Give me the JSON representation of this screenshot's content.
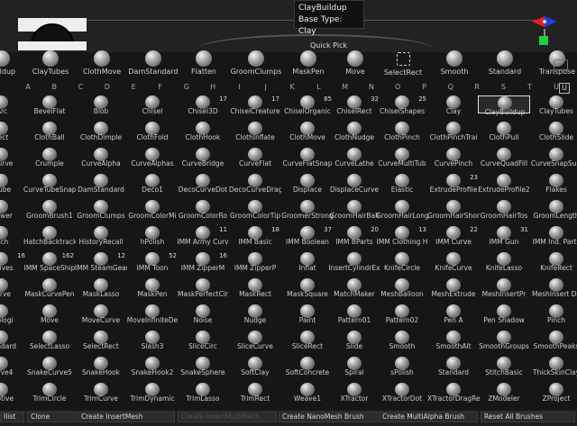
{
  "tooltip": {
    "title": "ClayBuildup",
    "subtitle": "Base Type: Clay"
  },
  "quick_pick": {
    "label": "Quick Pick",
    "items": [
      "Buildup",
      "ClayTubes",
      "ClothMove",
      "DamStandard",
      "Flatten",
      "GroomClumps",
      "MaskPen",
      "Move",
      "SelectRect",
      "Smooth",
      "Standard",
      "Transpose"
    ]
  },
  "letters": [
    "A",
    "B",
    "C",
    "D",
    "E",
    "F",
    "G",
    "H",
    "I",
    "J",
    "K",
    "L",
    "M",
    "N",
    "O",
    "P",
    "Q",
    "R",
    "S",
    "T",
    "U"
  ],
  "brush_rows": [
    [
      {
        "n": "lArc"
      },
      {
        "n": "BevelFlat"
      },
      {
        "n": "Blob"
      },
      {
        "n": "Chisel"
      },
      {
        "n": "Chisel3D",
        "c": "17"
      },
      {
        "n": "ChiselCreature",
        "c": "17"
      },
      {
        "n": "ChiselOrganic",
        "c": "85"
      },
      {
        "n": "ChiselRect",
        "c": "32"
      },
      {
        "n": "ChiselShapes",
        "c": "25"
      },
      {
        "n": "Clay"
      },
      {
        "n": "ClayBuildup",
        "hl": true
      },
      {
        "n": "ClayTubes"
      }
    ],
    [
      {
        "n": "Rect"
      },
      {
        "n": "ClothBall"
      },
      {
        "n": "ClothDimple"
      },
      {
        "n": "ClothFold"
      },
      {
        "n": "ClothHook"
      },
      {
        "n": "ClothInflate"
      },
      {
        "n": "ClothMove"
      },
      {
        "n": "ClothNudge"
      },
      {
        "n": "ClothPinch"
      },
      {
        "n": "ClothPinchTrai"
      },
      {
        "n": "ClothPull"
      },
      {
        "n": "ClothSlide"
      }
    ],
    [
      {
        "n": "eCurve"
      },
      {
        "n": "Crumple"
      },
      {
        "n": "CurveAlpha"
      },
      {
        "n": "CurveAlphas"
      },
      {
        "n": "CurveBridge"
      },
      {
        "n": "CurveFlat"
      },
      {
        "n": "CurveFlatSnap"
      },
      {
        "n": "CurveLathe"
      },
      {
        "n": "CurveMultiTub"
      },
      {
        "n": "CurvePinch"
      },
      {
        "n": "CurveQuadFill"
      },
      {
        "n": "CurveSnapSurf"
      }
    ],
    [
      {
        "n": "eTube"
      },
      {
        "n": "CurveTubeSnap"
      },
      {
        "n": "DamStandard"
      },
      {
        "n": "Deco1"
      },
      {
        "n": "DecoCurveDot"
      },
      {
        "n": "DecoCurveDrag"
      },
      {
        "n": "Displace"
      },
      {
        "n": "DisplaceCurve"
      },
      {
        "n": "Elastic"
      },
      {
        "n": "ExtrudeProfile",
        "c": "23"
      },
      {
        "n": "ExtrudeProfile2"
      },
      {
        "n": "Flakes"
      }
    ],
    [
      {
        "n": "Blower"
      },
      {
        "n": "GroomBrush1"
      },
      {
        "n": "GroomClumps"
      },
      {
        "n": "GroomColorMi"
      },
      {
        "n": "GroomColorRo"
      },
      {
        "n": "GroomColorTip"
      },
      {
        "n": "GroomerStrong"
      },
      {
        "n": "GroomHairBall"
      },
      {
        "n": "GroomHairLong"
      },
      {
        "n": "GroomHairShor"
      },
      {
        "n": "GroomHairTos"
      },
      {
        "n": "GroomLength"
      }
    ],
    [
      {
        "n": "atch"
      },
      {
        "n": "HatchBacktrack"
      },
      {
        "n": "HistoryRecall"
      },
      {
        "n": "hPolish"
      },
      {
        "n": "IMM Army Curv",
        "c": "11"
      },
      {
        "n": "IMM Basic",
        "c": "18"
      },
      {
        "n": "IMM Boolean",
        "c": "37"
      },
      {
        "n": "IMM BParts",
        "c": "20"
      },
      {
        "n": "IMM Clothing H",
        "c": "13"
      },
      {
        "n": "IMM Curve",
        "c": "22"
      },
      {
        "n": "IMM Gun",
        "c": "31"
      },
      {
        "n": "IMM Ind. Parts"
      }
    ],
    [
      {
        "n": "mitives",
        "c": "16"
      },
      {
        "n": "IMM SpaceShip",
        "c": "162"
      },
      {
        "n": "IMM SteamGear",
        "c": "12"
      },
      {
        "n": "IMM Toon",
        "c": "52"
      },
      {
        "n": "IMM ZipperM",
        "c": "16"
      },
      {
        "n": "IMM ZipperP"
      },
      {
        "n": "Inflat"
      },
      {
        "n": "InsertCylindrEx"
      },
      {
        "n": "KnifeCircle"
      },
      {
        "n": "KnifeCurve"
      },
      {
        "n": "KnifeLasso"
      },
      {
        "n": "KnifeRect"
      }
    ],
    [
      {
        "n": "Curve"
      },
      {
        "n": "MaskCurvePen"
      },
      {
        "n": "MaskLasso"
      },
      {
        "n": "MaskPen"
      },
      {
        "n": "MaskPerfectCir"
      },
      {
        "n": "MaskRect"
      },
      {
        "n": "MaskSquare"
      },
      {
        "n": "MatchMaker"
      },
      {
        "n": "MeshBalloon"
      },
      {
        "n": "MeshExtrude"
      },
      {
        "n": "MeshInsertPr"
      },
      {
        "n": "MeshInsert Do"
      }
    ],
    [
      {
        "n": "opologi"
      },
      {
        "n": "Move"
      },
      {
        "n": "MoveCurve"
      },
      {
        "n": "MoveInfiniteDe"
      },
      {
        "n": "Noise"
      },
      {
        "n": "Nudge"
      },
      {
        "n": "Paint"
      },
      {
        "n": "Pattern01"
      },
      {
        "n": "Pattern02"
      },
      {
        "n": "Pen A"
      },
      {
        "n": "Pen Shadow"
      },
      {
        "n": "Pinch"
      }
    ],
    [
      {
        "n": "Standard"
      },
      {
        "n": "SelectLasso"
      },
      {
        "n": "SelectRect"
      },
      {
        "n": "Slash3"
      },
      {
        "n": "SliceCirc"
      },
      {
        "n": "SliceCurve"
      },
      {
        "n": "SliceRect"
      },
      {
        "n": "Slide"
      },
      {
        "n": "Smooth"
      },
      {
        "n": "SmoothAlt"
      },
      {
        "n": "SmoothGroups"
      },
      {
        "n": "SmoothPeaks"
      }
    ],
    [
      {
        "n": "Curve4"
      },
      {
        "n": "SnakeCurve5"
      },
      {
        "n": "SnakeHook"
      },
      {
        "n": "SnakeHook2"
      },
      {
        "n": "SnakeSphere"
      },
      {
        "n": "SoftClay"
      },
      {
        "n": "SoftConcrete"
      },
      {
        "n": "Spiral"
      },
      {
        "n": "sPolish"
      },
      {
        "n": "Standard"
      },
      {
        "n": "StitchBasic"
      },
      {
        "n": "ThickSkinClay"
      }
    ],
    [
      {
        "n": "daptive"
      },
      {
        "n": "TrimCircle"
      },
      {
        "n": "TrimCurve"
      },
      {
        "n": "TrimDynamic"
      },
      {
        "n": "TrimLasso"
      },
      {
        "n": "TrimRect"
      },
      {
        "n": "Weave1"
      },
      {
        "n": "XTractor"
      },
      {
        "n": "XTractorDot"
      },
      {
        "n": "XTractorDragRe"
      },
      {
        "n": "ZModeler"
      },
      {
        "n": "ZProject"
      }
    ]
  ],
  "bottom_buttons": [
    {
      "label": "Ilist"
    },
    {
      "label": "Clone"
    },
    {
      "label": "Create InsertMesh"
    },
    {
      "label": "Create InsertMultiMesh",
      "disabled": true
    },
    {
      "label": "Create NanoMesh Brush"
    },
    {
      "label": "Create MultiAlpha Brush"
    },
    {
      "label": "Reset All Brushes"
    }
  ],
  "colors": {
    "background": "#161616",
    "highlight": "#dddddd",
    "gizmo_red": "#e0202a",
    "gizmo_green": "#20d040",
    "gizmo_blue": "#2040e0"
  }
}
